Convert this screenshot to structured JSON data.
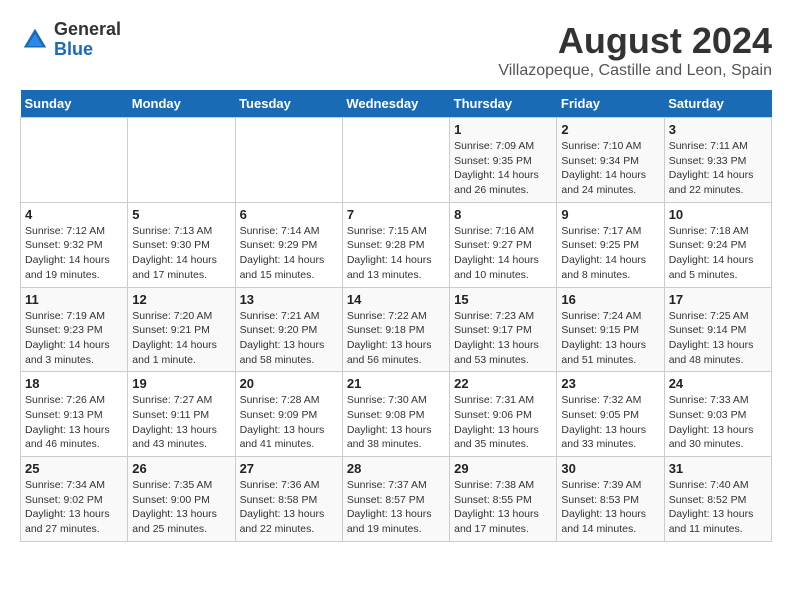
{
  "logo": {
    "general": "General",
    "blue": "Blue"
  },
  "title": "August 2024",
  "subtitle": "Villazopeque, Castille and Leon, Spain",
  "days_of_week": [
    "Sunday",
    "Monday",
    "Tuesday",
    "Wednesday",
    "Thursday",
    "Friday",
    "Saturday"
  ],
  "weeks": [
    [
      {
        "day": "",
        "info": ""
      },
      {
        "day": "",
        "info": ""
      },
      {
        "day": "",
        "info": ""
      },
      {
        "day": "",
        "info": ""
      },
      {
        "day": "1",
        "info": "Sunrise: 7:09 AM\nSunset: 9:35 PM\nDaylight: 14 hours and 26 minutes."
      },
      {
        "day": "2",
        "info": "Sunrise: 7:10 AM\nSunset: 9:34 PM\nDaylight: 14 hours and 24 minutes."
      },
      {
        "day": "3",
        "info": "Sunrise: 7:11 AM\nSunset: 9:33 PM\nDaylight: 14 hours and 22 minutes."
      }
    ],
    [
      {
        "day": "4",
        "info": "Sunrise: 7:12 AM\nSunset: 9:32 PM\nDaylight: 14 hours and 19 minutes."
      },
      {
        "day": "5",
        "info": "Sunrise: 7:13 AM\nSunset: 9:30 PM\nDaylight: 14 hours and 17 minutes."
      },
      {
        "day": "6",
        "info": "Sunrise: 7:14 AM\nSunset: 9:29 PM\nDaylight: 14 hours and 15 minutes."
      },
      {
        "day": "7",
        "info": "Sunrise: 7:15 AM\nSunset: 9:28 PM\nDaylight: 14 hours and 13 minutes."
      },
      {
        "day": "8",
        "info": "Sunrise: 7:16 AM\nSunset: 9:27 PM\nDaylight: 14 hours and 10 minutes."
      },
      {
        "day": "9",
        "info": "Sunrise: 7:17 AM\nSunset: 9:25 PM\nDaylight: 14 hours and 8 minutes."
      },
      {
        "day": "10",
        "info": "Sunrise: 7:18 AM\nSunset: 9:24 PM\nDaylight: 14 hours and 5 minutes."
      }
    ],
    [
      {
        "day": "11",
        "info": "Sunrise: 7:19 AM\nSunset: 9:23 PM\nDaylight: 14 hours and 3 minutes."
      },
      {
        "day": "12",
        "info": "Sunrise: 7:20 AM\nSunset: 9:21 PM\nDaylight: 14 hours and 1 minute."
      },
      {
        "day": "13",
        "info": "Sunrise: 7:21 AM\nSunset: 9:20 PM\nDaylight: 13 hours and 58 minutes."
      },
      {
        "day": "14",
        "info": "Sunrise: 7:22 AM\nSunset: 9:18 PM\nDaylight: 13 hours and 56 minutes."
      },
      {
        "day": "15",
        "info": "Sunrise: 7:23 AM\nSunset: 9:17 PM\nDaylight: 13 hours and 53 minutes."
      },
      {
        "day": "16",
        "info": "Sunrise: 7:24 AM\nSunset: 9:15 PM\nDaylight: 13 hours and 51 minutes."
      },
      {
        "day": "17",
        "info": "Sunrise: 7:25 AM\nSunset: 9:14 PM\nDaylight: 13 hours and 48 minutes."
      }
    ],
    [
      {
        "day": "18",
        "info": "Sunrise: 7:26 AM\nSunset: 9:13 PM\nDaylight: 13 hours and 46 minutes."
      },
      {
        "day": "19",
        "info": "Sunrise: 7:27 AM\nSunset: 9:11 PM\nDaylight: 13 hours and 43 minutes."
      },
      {
        "day": "20",
        "info": "Sunrise: 7:28 AM\nSunset: 9:09 PM\nDaylight: 13 hours and 41 minutes."
      },
      {
        "day": "21",
        "info": "Sunrise: 7:30 AM\nSunset: 9:08 PM\nDaylight: 13 hours and 38 minutes."
      },
      {
        "day": "22",
        "info": "Sunrise: 7:31 AM\nSunset: 9:06 PM\nDaylight: 13 hours and 35 minutes."
      },
      {
        "day": "23",
        "info": "Sunrise: 7:32 AM\nSunset: 9:05 PM\nDaylight: 13 hours and 33 minutes."
      },
      {
        "day": "24",
        "info": "Sunrise: 7:33 AM\nSunset: 9:03 PM\nDaylight: 13 hours and 30 minutes."
      }
    ],
    [
      {
        "day": "25",
        "info": "Sunrise: 7:34 AM\nSunset: 9:02 PM\nDaylight: 13 hours and 27 minutes."
      },
      {
        "day": "26",
        "info": "Sunrise: 7:35 AM\nSunset: 9:00 PM\nDaylight: 13 hours and 25 minutes."
      },
      {
        "day": "27",
        "info": "Sunrise: 7:36 AM\nSunset: 8:58 PM\nDaylight: 13 hours and 22 minutes."
      },
      {
        "day": "28",
        "info": "Sunrise: 7:37 AM\nSunset: 8:57 PM\nDaylight: 13 hours and 19 minutes."
      },
      {
        "day": "29",
        "info": "Sunrise: 7:38 AM\nSunset: 8:55 PM\nDaylight: 13 hours and 17 minutes."
      },
      {
        "day": "30",
        "info": "Sunrise: 7:39 AM\nSunset: 8:53 PM\nDaylight: 13 hours and 14 minutes."
      },
      {
        "day": "31",
        "info": "Sunrise: 7:40 AM\nSunset: 8:52 PM\nDaylight: 13 hours and 11 minutes."
      }
    ]
  ]
}
